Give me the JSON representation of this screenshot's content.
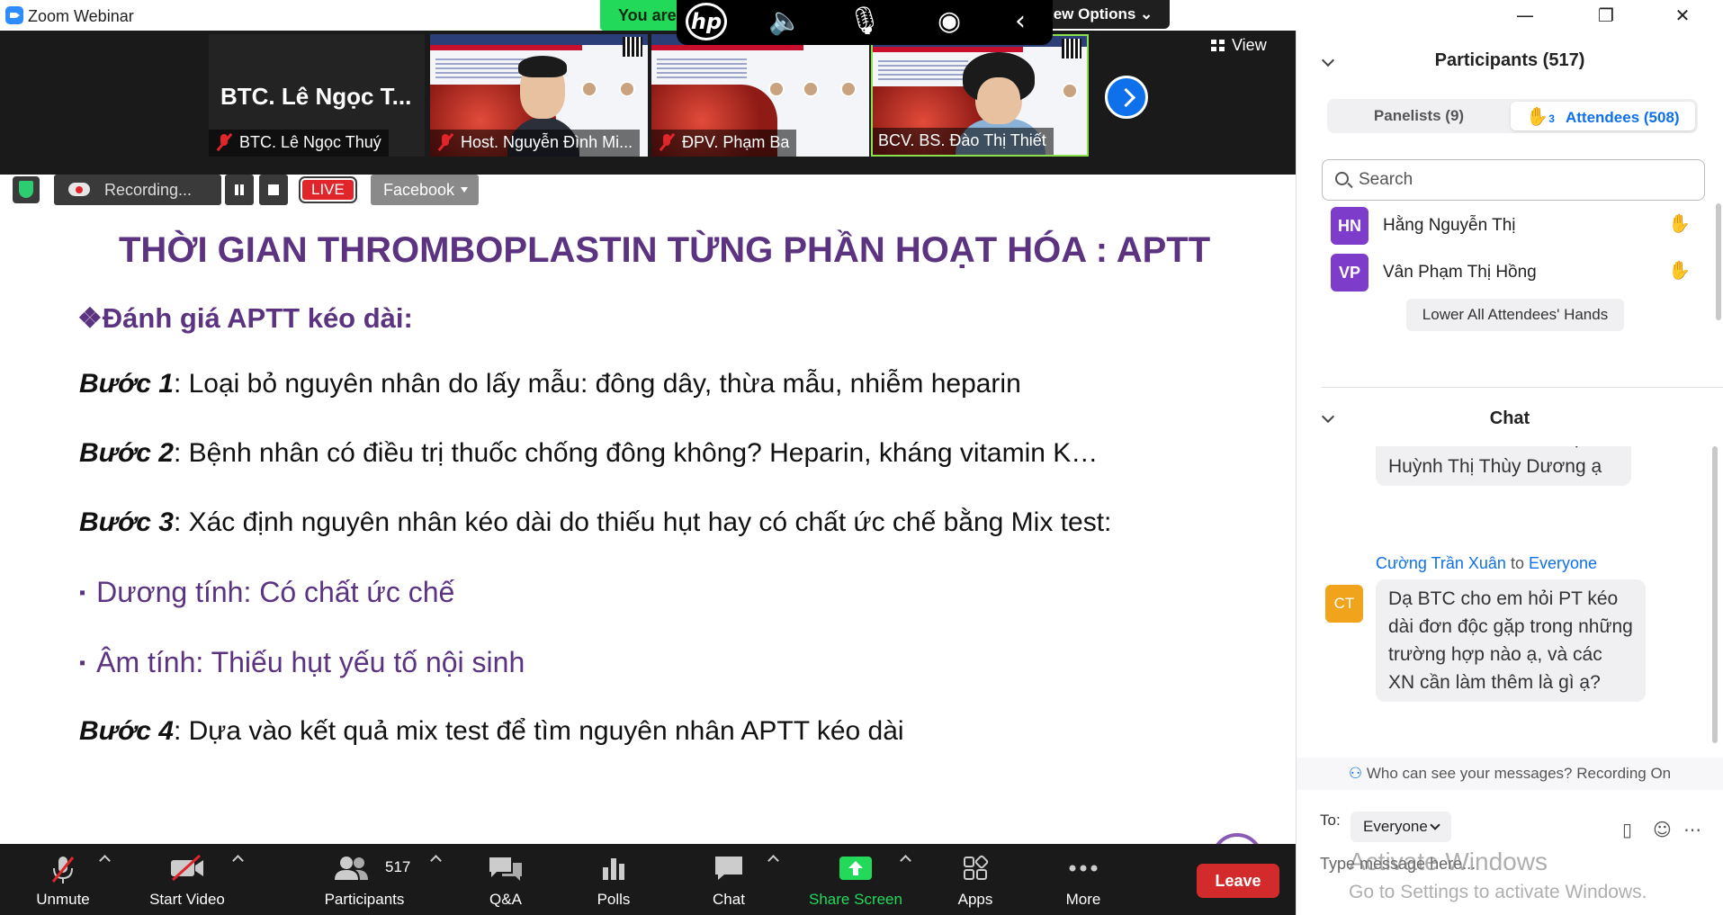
{
  "window": {
    "title": "Zoom Webinar",
    "minimize": "—",
    "restore": "❐",
    "close": "✕"
  },
  "overlays": {
    "banner_text": "You are",
    "view_options": "iew Options ⌄",
    "hp_logo": "hp"
  },
  "video_strip": {
    "active_speaker_name": "BTC. Lê Ngọc T...",
    "tiles": [
      {
        "label": "BTC. Lê Ngọc Thuý"
      },
      {
        "label": "Host. Nguyễn Đình Mi..."
      },
      {
        "label": "ĐPV. Phạm Ba"
      },
      {
        "label": "BCV. BS. Đào Thị Thiết"
      }
    ],
    "view_label": "View"
  },
  "recording": {
    "status": "Recording...",
    "live_label": "LIVE",
    "stream_target": "Facebook"
  },
  "slide": {
    "title": "THỜI GIAN THROMBOPLASTIN TỪNG PHẦN HOẠT HÓA : APTT",
    "subtitle": "❖Đánh giá APTT kéo dài:",
    "steps": [
      {
        "label": "Bước 1",
        "text": ": Loại bỏ nguyên nhân do lấy mẫu: đông dây, thừa mẫu, nhiễm heparin"
      },
      {
        "label": "Bước 2",
        "text": ": Bệnh nhân có điều trị thuốc chống đông không? Heparin, kháng vitamin K…"
      },
      {
        "label": "Bước 3",
        "text": ": Xác định nguyên nhân kéo dài do thiếu hụt hay có chất ức chế bằng Mix test:"
      },
      {
        "label": "Bước 4",
        "text": ": Dựa vào kết quả mix test để tìm nguyên nhân APTT kéo dài"
      }
    ],
    "bullets": [
      "Dương tính: Có chất ức chế",
      "Âm tính: Thiếu hụt yếu tố nội sinh"
    ]
  },
  "toolbar": {
    "unmute": "Unmute",
    "start_video": "Start Video",
    "participants": "Participants",
    "participant_count": "517",
    "qa": "Q&A",
    "polls": "Polls",
    "chat": "Chat",
    "share_screen": "Share Screen",
    "apps": "Apps",
    "more": "More",
    "leave": "Leave"
  },
  "participants_panel": {
    "title": "Participants (517)",
    "tab_panelists": "Panelists (9)",
    "tab_attendees": "Attendees (508)",
    "raised_hands_count": "3",
    "search_placeholder": "Search",
    "raised": [
      {
        "initials": "HN",
        "name": "Hằng Nguyễn Thị"
      },
      {
        "initials": "VP",
        "name": "Vân Phạm Thị Hồng"
      }
    ],
    "lower_hands_button": "Lower All Attendees' Hands"
  },
  "chat_panel": {
    "title": "Chat",
    "prev_message_tail": "Đinh Thanh Yến và chị Huỳnh Thị Thùy Dương ạ",
    "message": {
      "sender": "Cường Trần Xuân",
      "to_word": "to",
      "recipient": "Everyone",
      "initials": "CT",
      "text": "Dạ BTC cho em hỏi PT kéo dài đơn độc gặp trong những trường hợp nào ạ, và các XN cần làm thêm là gì ạ?"
    },
    "visibility_note": "Who can see your messages? Recording On",
    "to_label": "To:",
    "to_value": "Everyone",
    "input_placeholder": "Type message here..."
  },
  "watermark": {
    "line1": "Activate Windows",
    "line2": "Go to Settings to activate Windows."
  },
  "colors": {
    "accent": "#0e71eb",
    "slide_purple": "#5b3381",
    "live_red": "#e0262b",
    "share_green": "#23d959",
    "leave_red": "#d32b2b"
  }
}
